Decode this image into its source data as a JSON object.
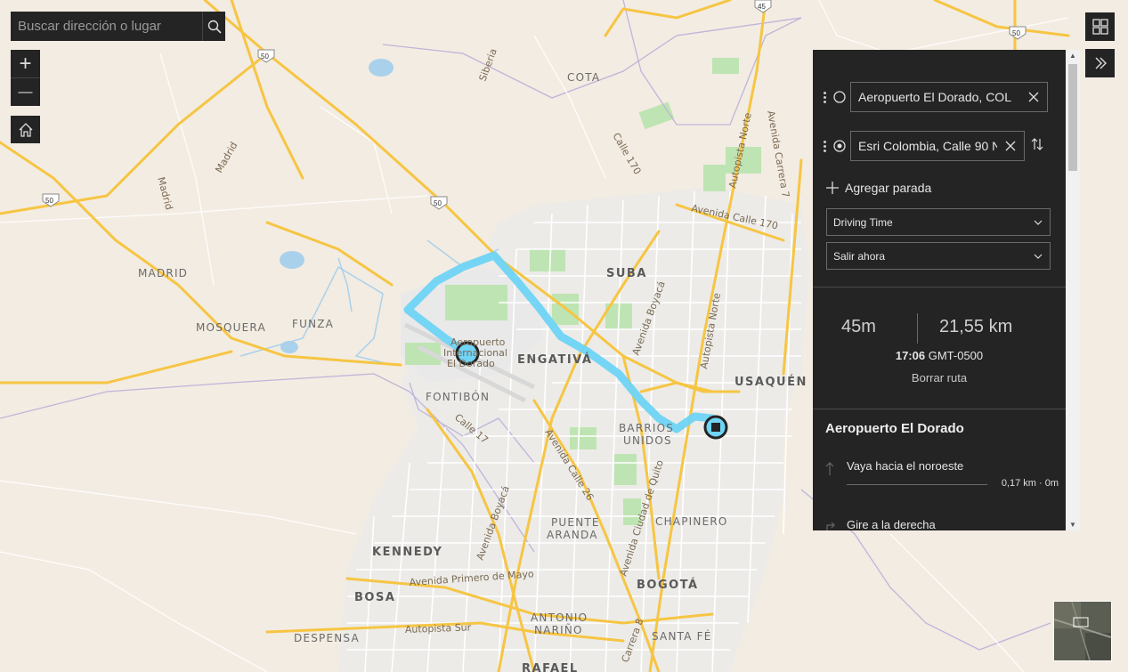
{
  "search": {
    "placeholder": "Buscar dirección o lugar"
  },
  "map_controls": {
    "zoom_in_symbol": "+",
    "zoom_out_symbol": "—"
  },
  "map": {
    "places": {
      "madrid": "MADRID",
      "mosquera": "MOSQUERA",
      "funza": "FUNZA",
      "cota": "COTA",
      "suba": "SUBA",
      "engativa": "ENGATIVÁ",
      "usaquen": "USAQUÉN",
      "fontibon": "FONTIBÓN",
      "barrios1": "BARRIOS",
      "barrios2": "UNIDOS",
      "chapinero": "CHAPINERO",
      "puente1": "PUENTE",
      "puente2": "ARANDA",
      "kennedy": "KENNEDY",
      "bosa": "BOSA",
      "bogota": "BOGOTÁ",
      "antonio1": "ANTONIO",
      "antonio2": "NARIÑO",
      "santafe": "SANTA FÉ",
      "despensa": "DESPENSA",
      "rafael": "RAFAEL"
    },
    "roads": {
      "madrid_road": "Madrid",
      "madrid_road2": "Madrid",
      "siberia": "Siberia",
      "calle170": "Calle 170",
      "av_calle170": "Avenida Calle 170",
      "autopista_norte": "Autopista Norte",
      "autopista_norte2": "Autopista Norte",
      "av_carrera7": "Avenida Carrera 7",
      "av_boyaca": "Avenida Boyacá",
      "av_boyaca2": "Avenida Boyacá",
      "calle17": "Calle 17",
      "av_calle26": "Avenida Calle 26",
      "av_quito": "Avenida Ciudad de Quito",
      "av_primero_mayo": "Avenida Primero de Mayo",
      "autopista_sur": "Autopista Sur",
      "carrera8": "Carrera 8",
      "airport1": "Aeropuerto",
      "airport2": "Internacional",
      "airport3": "El Dorado"
    },
    "shields": {
      "s50a": "50",
      "s50b": "50",
      "s50c": "50",
      "s50d": "50",
      "s45": "45"
    },
    "route_color": "#6fd4f5"
  },
  "panel": {
    "origin": "Aeropuerto El Dorado, COL",
    "destination": "Esri Colombia, Calle 90 N",
    "add_stop": "Agregar parada",
    "mode": "Driving Time",
    "depart": "Salir ahora",
    "summary": {
      "time": "45m",
      "distance": "21,55 km",
      "eta_time": "17:06",
      "eta_zone": "GMT-0500",
      "clear": "Borrar ruta"
    },
    "origin_title": "Aeropuerto El Dorado",
    "steps": [
      {
        "label": "Vaya hacia el noroeste",
        "distance": "0,17 km · 0m"
      },
      {
        "label": "Gire a la derecha",
        "distance": ""
      }
    ]
  }
}
